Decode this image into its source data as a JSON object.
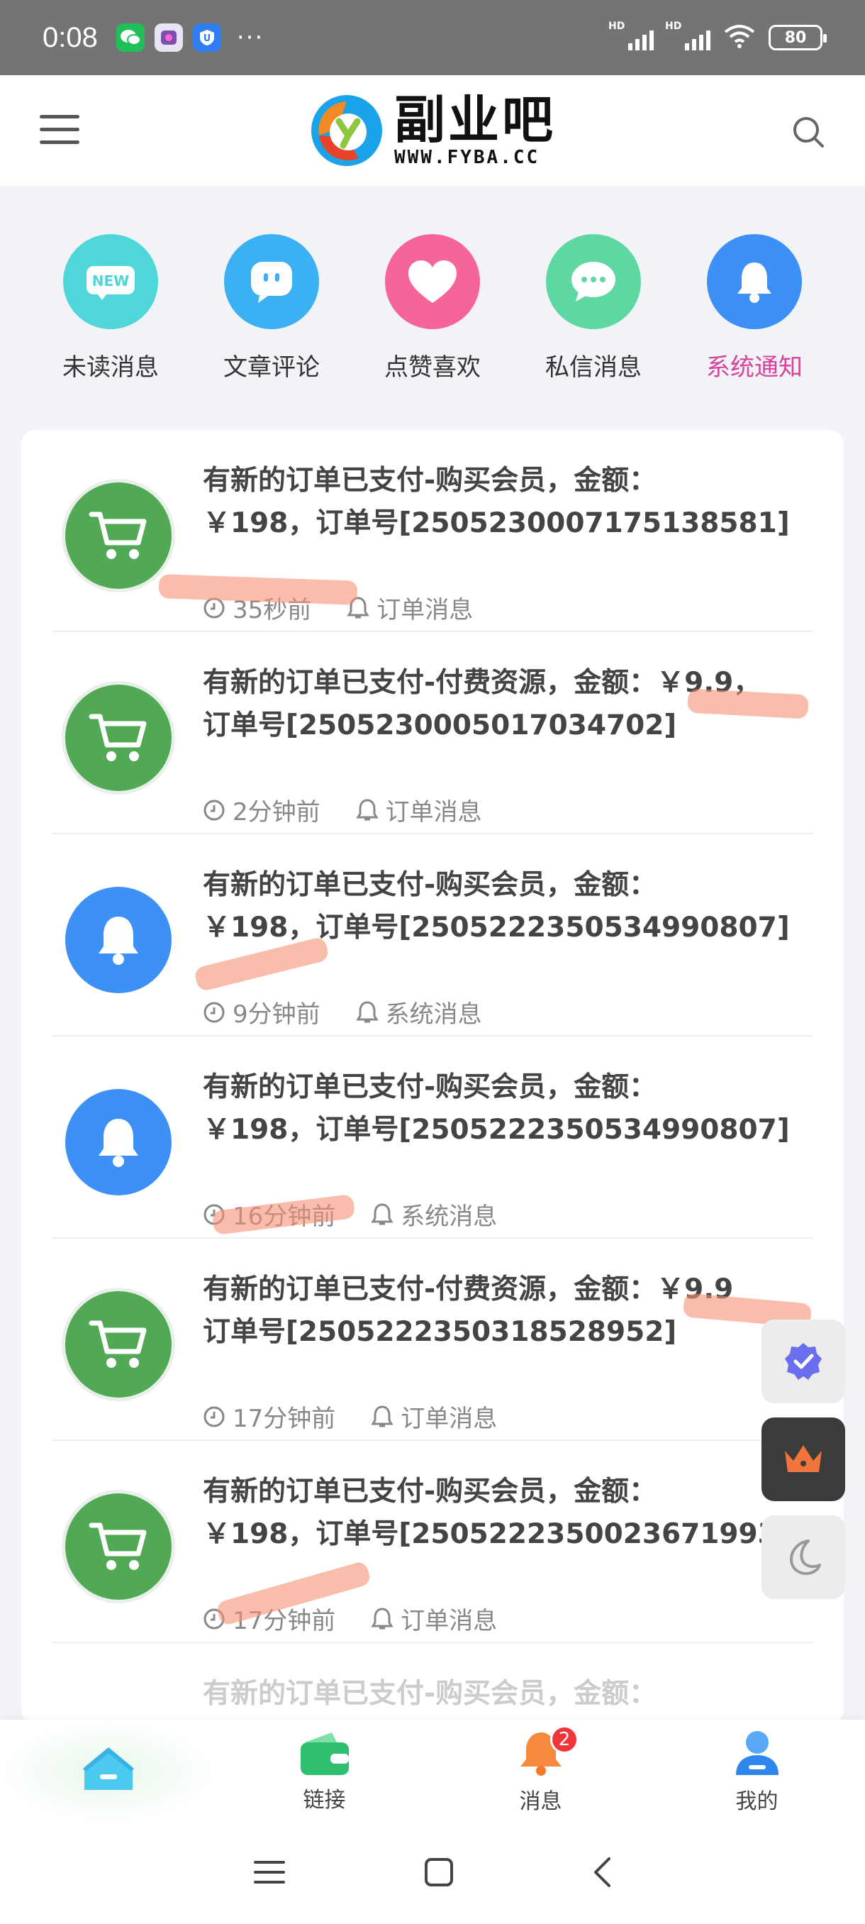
{
  "status_bar": {
    "time": "0:08",
    "network_label": "HD",
    "battery": "80"
  },
  "header": {
    "logo_cn": "副业吧",
    "logo_en": "WWW.FYBA.CC"
  },
  "categories": [
    {
      "label": "未读消息",
      "icon": "new-badge-icon",
      "color": "#4fd6d8"
    },
    {
      "label": "文章评论",
      "icon": "chat-bubble-icon",
      "color": "#3bb0f3"
    },
    {
      "label": "点赞喜欢",
      "icon": "heart-icon",
      "color": "#f5659c"
    },
    {
      "label": "私信消息",
      "icon": "message-icon",
      "color": "#5ed8a2"
    },
    {
      "label": "系统通知",
      "icon": "bell-icon",
      "color": "#3d90f5",
      "active": true
    }
  ],
  "notifications": [
    {
      "line1": "有新的订单已支付-购买会员，金额：",
      "line2": "￥198，订单号[2505230007175138581]",
      "time": "35秒前",
      "type": "订单消息",
      "icon": "cart-icon"
    },
    {
      "line1": "有新的订单已支付-付费资源，金额：￥9.9，",
      "line2": "订单号[2505230005017034702]",
      "time": "2分钟前",
      "type": "订单消息",
      "icon": "cart-icon"
    },
    {
      "line1": "有新的订单已支付-购买会员，金额：",
      "line2": "￥198，订单号[2505222350534990807]",
      "time": "9分钟前",
      "type": "系统消息",
      "icon": "bell-icon"
    },
    {
      "line1": "有新的订单已支付-购买会员，金额：",
      "line2": "￥198，订单号[2505222350534990807]",
      "time": "16分钟前",
      "type": "系统消息",
      "icon": "bell-icon"
    },
    {
      "line1": "有新的订单已支付-付费资源，金额：￥9.9",
      "line2": "订单号[2505222350318528952]",
      "time": "17分钟前",
      "type": "订单消息",
      "icon": "cart-icon"
    },
    {
      "line1": "有新的订单已支付-购买会员，金额：",
      "line2": "￥198，订单号[2505222350023671993]",
      "time": "17分钟前",
      "type": "订单消息",
      "icon": "cart-icon"
    },
    {
      "line1": "有新的订单已支付-购买会员，金额：",
      "line2": "",
      "time": "",
      "type": "",
      "icon": ""
    }
  ],
  "bottom_nav": [
    {
      "label": "",
      "icon": "home-icon"
    },
    {
      "label": "链接",
      "icon": "wallet-icon"
    },
    {
      "label": "消息",
      "icon": "bell-icon",
      "badge": "2"
    },
    {
      "label": "我的",
      "icon": "user-icon"
    }
  ]
}
